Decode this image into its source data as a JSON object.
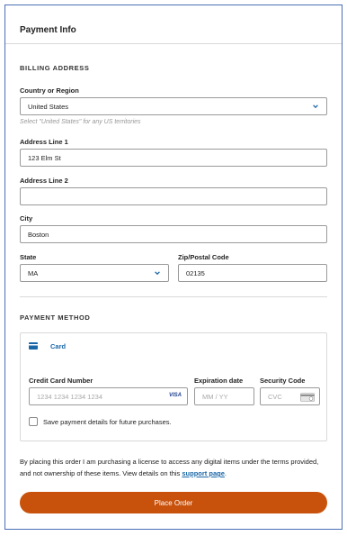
{
  "header": {
    "title": "Payment Info"
  },
  "billing": {
    "section_title": "BILLING ADDRESS",
    "country_label": "Country or Region",
    "country_value": "United States",
    "country_hint": "Select \"United States\" for any US territories",
    "address1_label": "Address Line 1",
    "address1_value": "123 Elm St",
    "address2_label": "Address Line 2",
    "address2_value": "",
    "city_label": "City",
    "city_value": "Boston",
    "state_label": "State",
    "state_value": "MA",
    "zip_label": "Zip/Postal Code",
    "zip_value": "02135"
  },
  "payment": {
    "section_title": "PAYMENT METHOD",
    "method_label": "Card",
    "cc_label": "Credit Card Number",
    "cc_placeholder": "1234 1234 1234 1234",
    "cc_brand": "VISA",
    "exp_label": "Expiration date",
    "exp_placeholder": "MM / YY",
    "cvc_label": "Security Code",
    "cvc_placeholder": "CVC",
    "save_label": "Save payment details for future purchases."
  },
  "legal": {
    "text": "By placing this order I am purchasing a license to access any digital items under the terms provided, and not ownership of these items. View details on this ",
    "link": "support page",
    "end": "."
  },
  "actions": {
    "place_order": "Place Order"
  },
  "colors": {
    "accent": "#c8520c",
    "link": "#1a67a8",
    "border": "#4a6fb5"
  },
  "icons": {
    "select": "chevron-down-icon",
    "card": "credit-card-icon",
    "cvc": "card-back-icon"
  }
}
